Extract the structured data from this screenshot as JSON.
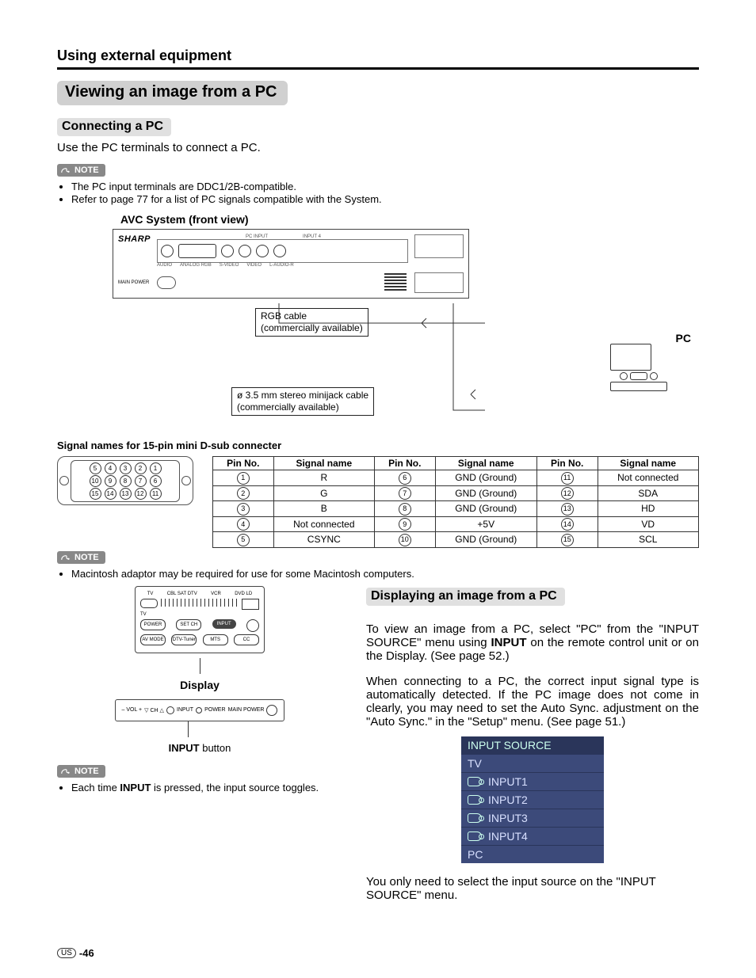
{
  "chapter": "Using external equipment",
  "section_title": "Viewing an image from a PC",
  "connecting": {
    "heading": "Connecting a PC",
    "intro": "Use the PC terminals to connect a PC.",
    "note_label": "NOTE",
    "notes": [
      "The PC input terminals are DDC1/2B-compatible.",
      "Refer to page 77 for a list of PC signals compatible with the System."
    ]
  },
  "avc": {
    "title": "AVC System (front view)",
    "brand": "SHARP",
    "port_group_labels": [
      "PC INPUT",
      "INPUT 4"
    ],
    "port_labels": [
      "AUDIO",
      "ANALOG RGB",
      "S-VIDEO",
      "VIDEO",
      "L-AUDIO-R"
    ],
    "power_label": "MAIN POWER",
    "rgb_cable": "RGB cable\n(commercially available)",
    "minijack": "ø 3.5 mm stereo minijack cable\n(commercially available)",
    "pc_label": "PC"
  },
  "connector": {
    "heading": "Signal names for 15-pin mini D-sub connecter",
    "headers": [
      "Pin No.",
      "Signal name",
      "Pin No.",
      "Signal name",
      "Pin No.",
      "Signal name"
    ],
    "rows": [
      [
        "1",
        "R",
        "6",
        "GND (Ground)",
        "11",
        "Not connected"
      ],
      [
        "2",
        "G",
        "7",
        "GND (Ground)",
        "12",
        "SDA"
      ],
      [
        "3",
        "B",
        "8",
        "GND (Ground)",
        "13",
        "HD"
      ],
      [
        "4",
        "Not connected",
        "9",
        "+5V",
        "14",
        "VD"
      ],
      [
        "5",
        "CSYNC",
        "10",
        "GND (Ground)",
        "15",
        "SCL"
      ]
    ],
    "note_label": "NOTE",
    "note": "Macintosh adaptor may be required for use for some Macintosh computers."
  },
  "remote": {
    "top_labels": [
      "TV",
      "CBL SAT DTV",
      "VCR",
      "DVD LD"
    ],
    "row1": [
      "POWER",
      "SET CH",
      "INPUT",
      ""
    ],
    "row2": [
      "AV MODE",
      "DTV-Tuner",
      "MTS",
      "CC"
    ],
    "display_label": "Display",
    "panel_labels": [
      "– VOL +",
      "▽ CH △",
      "INPUT",
      "POWER",
      "MAIN POWER"
    ],
    "input_caption_prefix": "INPUT",
    "input_caption_suffix": " button",
    "note_label": "NOTE",
    "note_prefix": "Each time ",
    "note_bold": "INPUT",
    "note_suffix": " is pressed, the input source toggles."
  },
  "displaying": {
    "heading": "Displaying an image from a PC",
    "p1_a": "To view an image from a PC, select \"PC\" from the \"INPUT SOURCE\" menu using ",
    "p1_bold": "INPUT",
    "p1_b": " on the remote control unit or on the Display. (See page 52.)",
    "p2": "When connecting to a PC, the correct input signal type is automatically detected.  If the PC image does not come in clearly, you may need to set the Auto Sync. adjustment on the \"Auto Sync.\" in the \"Setup\" menu. (See page 51.)",
    "osd_title": "INPUT SOURCE",
    "osd_items": [
      "TV",
      "INPUT1",
      "INPUT2",
      "INPUT3",
      "INPUT4",
      "PC"
    ],
    "p3": "You only need to select the input source on the \"INPUT SOURCE\" menu."
  },
  "footer": {
    "region": "US",
    "page": "-46"
  }
}
